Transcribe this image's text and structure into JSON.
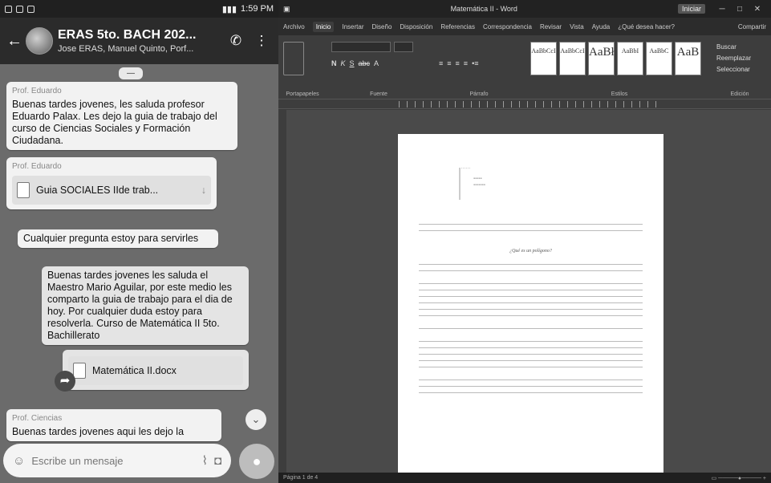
{
  "phone": {
    "status_time": "1:59 PM",
    "header": {
      "title": "ERAS 5to. BACH 202...",
      "subtitle": "Jose ERAS, Manuel Quinto, Porf..."
    },
    "messages": [
      {
        "sender": "Prof. Eduardo",
        "text": "Buenas tardes jovenes, les saluda profesor Eduardo Palax. Les dejo la guia de trabajo del curso de Ciencias Sociales y Formación Ciudadana."
      },
      {
        "sender": "Prof. Eduardo",
        "file_name": "Guia SOCIALES IIde trab..."
      },
      {
        "text": "Cualquier pregunta estoy para servirles"
      },
      {
        "text": "Buenas tardes jovenes les saluda el Maestro Mario Aguilar, por este medio les comparto la guia de trabajo para el dia de hoy. Por cualquier duda estoy para resolverla. Curso de Matemática II 5to. Bachillerato"
      },
      {
        "file_name": "Matemática II.docx"
      },
      {
        "sender": "Prof. Ciencias",
        "text": "Buenas tardes jovenes aqui les dejo la"
      }
    ],
    "input_placeholder": "Escribe un mensaje"
  },
  "word": {
    "window_title": "Matemática II - Word",
    "account_label": "Iniciar",
    "tabs": [
      "Archivo",
      "Inicio",
      "Insertar",
      "Diseño",
      "Disposición",
      "Referencias",
      "Correspondencia",
      "Revisar",
      "Vista",
      "Ayuda",
      "¿Qué desea hacer?"
    ],
    "share_label": "Compartir",
    "ribbon_groups": [
      "Portapapeles",
      "Fuente",
      "Párrafo",
      "Estilos",
      "Edición"
    ],
    "style_tiles": [
      "AaBbCcI",
      "AaBbCcI",
      "AaBł",
      "AaBbI",
      "AaBbC",
      "AaB",
      "AaBbCcI"
    ],
    "editing": [
      "Buscar",
      "Reemplazar",
      "Seleccionar"
    ],
    "document": {
      "heading": "¿Qué es un polígono?"
    },
    "status_left": "Página 1 de 4"
  }
}
